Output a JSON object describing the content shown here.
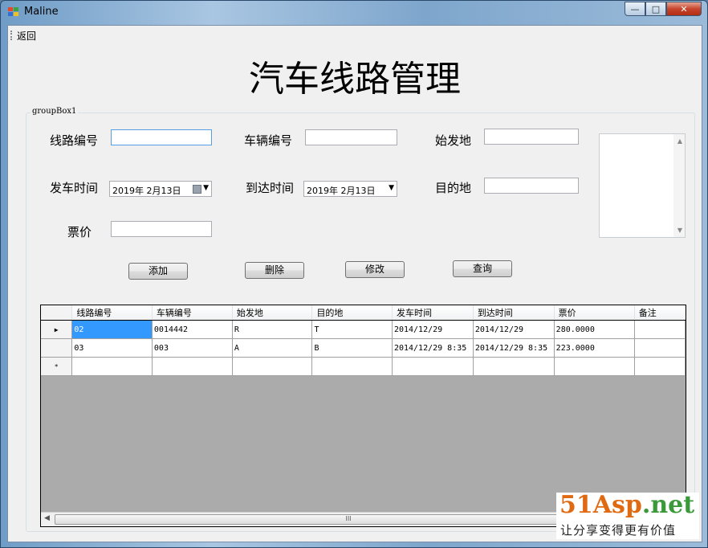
{
  "window": {
    "title": "Maline",
    "buttons": {
      "minimize": "—",
      "maximize": "□",
      "close": "✕"
    }
  },
  "menu": {
    "back": "返回"
  },
  "heading": "汽车线路管理",
  "groupbox": {
    "label": "groupBox1"
  },
  "form": {
    "route_no_label": "线路编号",
    "route_no_value": "",
    "vehicle_no_label": "车辆编号",
    "vehicle_no_value": "",
    "origin_label": "始发地",
    "origin_value": "",
    "depart_time_label": "发车时间",
    "depart_time_value": "2019年 2月13日",
    "arrive_time_label": "到达时间",
    "arrive_time_value": "2019年 2月13日",
    "destination_label": "目的地",
    "destination_value": "",
    "price_label": "票价",
    "price_value": ""
  },
  "buttons": {
    "add": "添加",
    "delete": "删除",
    "modify": "修改",
    "query": "查询"
  },
  "grid": {
    "columns": [
      "线路编号",
      "车辆编号",
      "始发地",
      "目的地",
      "发车时间",
      "到达时间",
      "票价",
      "备注"
    ],
    "rows": [
      {
        "indicator": "▶",
        "cells": [
          "02",
          "0014442",
          "R",
          "T",
          "2014/12/29",
          "2014/12/29",
          "280.0000",
          ""
        ]
      },
      {
        "indicator": "",
        "cells": [
          "03",
          "003",
          "A",
          "B",
          "2014/12/29 8:35",
          "2014/12/29 8:35",
          "223.0000",
          ""
        ]
      },
      {
        "indicator": "*",
        "cells": [
          "",
          "",
          "",
          "",
          "",
          "",
          "",
          ""
        ]
      }
    ],
    "scroll_thumb_label": "III"
  },
  "watermark": {
    "brand": "51Asp",
    "tld": ".net",
    "slogan": "让分享变得更有价值"
  },
  "colors": {
    "selection": "#3399ff",
    "close_button": "#c7452d",
    "brand_orange": "#e06a12",
    "brand_green": "#3a9a3a",
    "grid_background": "#ababab"
  }
}
